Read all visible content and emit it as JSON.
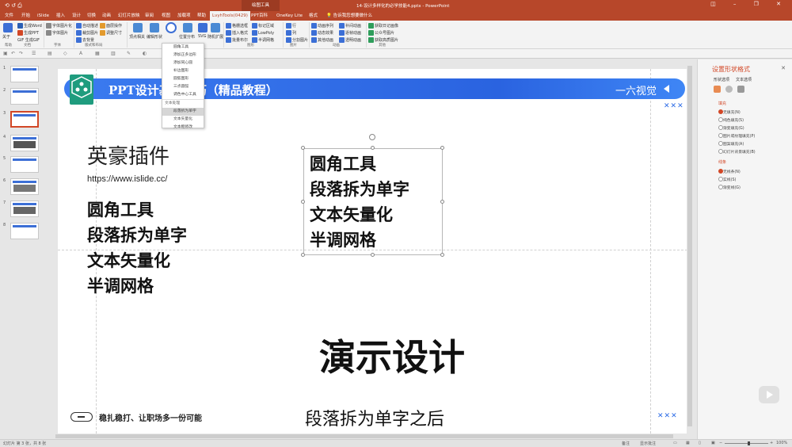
{
  "titlebar": {
    "quick_access": "⟲ ↺ ⎙",
    "context_tab": "绘图工具",
    "document_title": "14-设计多样化的必学技能4.pptx  -  PowerPoint",
    "window_controls": "◫ – ❐ ✕"
  },
  "tabs": [
    {
      "label": "文件"
    },
    {
      "label": "开始"
    },
    {
      "label": "iSlide"
    },
    {
      "label": "插入"
    },
    {
      "label": "设计"
    },
    {
      "label": "切换"
    },
    {
      "label": "动画"
    },
    {
      "label": "幻灯片放映"
    },
    {
      "label": "审阅"
    },
    {
      "label": "视图"
    },
    {
      "label": "加载项"
    },
    {
      "label": "帮助"
    },
    {
      "label": "LvyhTools(0429)"
    },
    {
      "label": "PPT百科"
    },
    {
      "label": "OneKey Lite"
    },
    {
      "label": "格式"
    }
  ],
  "tell_me": "告诉我您想要做什么",
  "ribbon": {
    "left_buttons": [
      "生成Word",
      "生成PPT",
      "GIF 生成GIF"
    ],
    "btn_about": "关于",
    "font_buttons": [
      "字体图片化",
      "字体图片"
    ],
    "layout_buttons": [
      "自动描述",
      "裁剪图片",
      "去背景",
      "面层操作",
      "调整尺寸"
    ],
    "cut_buttons": [
      "顶点相关",
      "编辑形状",
      "位置分布",
      "SVG",
      "随机扩展"
    ],
    "mid_buttons": [
      "格栅选框",
      "插入格式",
      "批量布尔",
      "标记区域",
      "LowPoly",
      "半调网格"
    ],
    "grid_buttons": [
      "行",
      "列",
      "分割图片"
    ],
    "anim_buttons": [
      "动画序列",
      "动态效果",
      "其他动画",
      "补间动画",
      "逐帧动画",
      "透明动画"
    ],
    "other_buttons": [
      "获取日记画像",
      "公众号图片",
      "获取高质图片"
    ],
    "group_labels": [
      "帮助",
      "文档",
      "字体",
      "版式和布局",
      "编辑",
      "图形",
      "图片",
      "动画",
      "其他"
    ]
  },
  "dropdown": {
    "items": [
      "圆角工具",
      "添加正多边形",
      "添加同心圆",
      "补边图形",
      "圆弧图形",
      "三点圆弧",
      "调色中心工具"
    ],
    "text_section_label": "文本处理",
    "text_items": [
      "段落拆为单字",
      "文本矢量化",
      "文本框修改"
    ],
    "highlighted": "段落拆为单字"
  },
  "thumbnails": [
    "1",
    "2",
    "3",
    "4",
    "5",
    "6",
    "7",
    "8"
  ],
  "slide": {
    "banner_title": "PPT设计基础技巧（精品教程）",
    "banner_right": "一六视觉",
    "xxx_top": "✕✕✕",
    "xxx_bottom": "✕✕✕",
    "brand": "英豪插件",
    "url": "https://www.islide.cc/",
    "left_lines": [
      "圆角工具",
      "段落拆为单字",
      "文本矢量化",
      "半调网格"
    ],
    "right_lines": [
      "圆角工具",
      "段落拆为单字",
      "文本矢量化",
      "半调网格"
    ],
    "big_title": "演示设计",
    "footer_text": "稳扎稳打、让职场多一份可能",
    "subtitle": "段落拆为单字之后"
  },
  "format_pane": {
    "title": "设置形状格式",
    "close": "✕",
    "tabs": [
      "形状选项",
      "文本选项"
    ],
    "fill_section": "填充",
    "fill_options": [
      "无填充(N)",
      "纯色填充(S)",
      "渐变填充(G)",
      "图片或纹理填充(P)",
      "图案填充(A)",
      "幻灯片背景填充(B)"
    ],
    "line_section": "线条",
    "line_options": [
      "无线条(N)",
      "实线(S)",
      "渐变线(G)"
    ]
  },
  "status": {
    "slide_info": "幻灯片 第 3 张，共 8 张",
    "notes": "备注",
    "comments": "显示批注",
    "zoom": "100%"
  },
  "colors": {
    "accent": "#b7472a",
    "banner_blue": "#2a63e0",
    "logo_teal": "#1f9c7e",
    "pane_orange": "#d24726"
  }
}
